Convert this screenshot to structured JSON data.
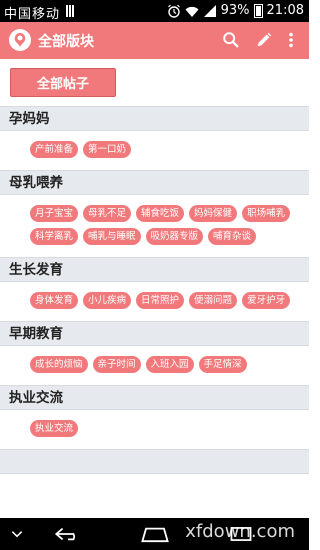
{
  "status_bar": {
    "carrier": "中国移动",
    "battery_percent": "93%",
    "time": "21:08"
  },
  "app_bar": {
    "title": "全部版块",
    "icons": [
      "app-logo-icon",
      "search-icon",
      "edit-icon",
      "more-vert-icon"
    ]
  },
  "all_posts_button": "全部帖子",
  "sections": [
    {
      "title": "孕妈妈",
      "tags": [
        "产前准备",
        "第一口奶"
      ]
    },
    {
      "title": "母乳喂养",
      "tags": [
        "月子宝宝",
        "母乳不足",
        "辅食吃饭",
        "妈妈保健",
        "职场哺乳",
        "科学离乳",
        "哺乳与睡眠",
        "吸奶器专版",
        "哺育杂谈"
      ]
    },
    {
      "title": "生长发育",
      "tags": [
        "身体发育",
        "小儿疾病",
        "日常照护",
        "便溺问题",
        "爱牙护牙"
      ]
    },
    {
      "title": "早期教育",
      "tags": [
        "成长的烦恼",
        "亲子时间",
        "入班入园",
        "手足情深"
      ]
    },
    {
      "title": "执业交流",
      "tags": [
        "执业交流"
      ]
    }
  ],
  "nav_bar": {
    "watermark": "xfdown.com",
    "icons": [
      "chevron-down-icon",
      "back-icon",
      "home-icon",
      "recents-icon"
    ]
  },
  "colors": {
    "accent": "#f2797b",
    "section_bg": "#e6e9ed",
    "status_bar_bg": "#000000"
  }
}
